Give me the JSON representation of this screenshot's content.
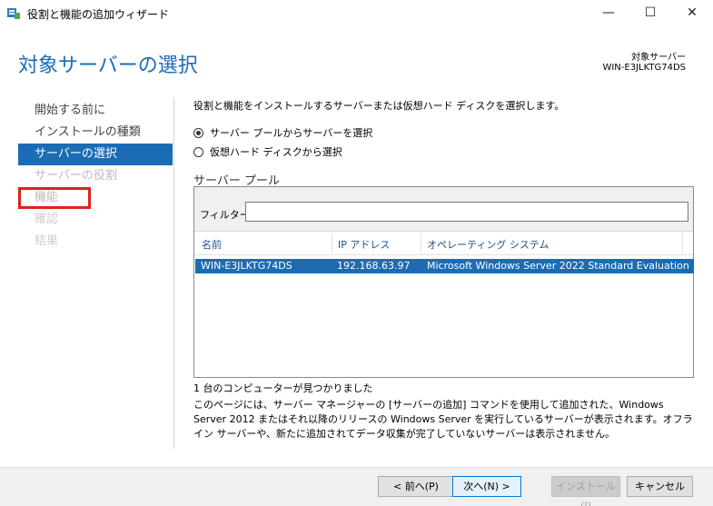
{
  "window": {
    "title": "役割と機能の追加ウィザード",
    "minimize_glyph": "—",
    "maximize_glyph": "☐",
    "close_glyph": "✕"
  },
  "header": {
    "page_title": "対象サーバーの選択",
    "target_label": "対象サーバー",
    "target_name": "WIN-E3JLKTG74DS"
  },
  "nav": {
    "items": [
      {
        "label": "開始する前に"
      },
      {
        "label": "インストールの種類"
      },
      {
        "label": "サーバーの選択"
      },
      {
        "label": "サーバーの役割"
      },
      {
        "label": "機能"
      },
      {
        "label": "確認"
      },
      {
        "label": "結果"
      }
    ]
  },
  "content": {
    "instruction": "役割と機能をインストールするサーバーまたは仮想ハード ディスクを選択します。",
    "radio_pool": "サーバー プールからサーバーを選択",
    "radio_vhd": "仮想ハード ディスクから選択",
    "pool_label": "サーバー プール",
    "filter_label": "フィルター:",
    "filter_value": "",
    "columns": [
      "名前",
      "IP アドレス",
      "オペレーティング システム"
    ],
    "rows": [
      {
        "name": "WIN-E3JLKTG74DS",
        "ip": "192.168.63.97",
        "os": "Microsoft Windows Server 2022 Standard Evaluation"
      }
    ],
    "found_text": "1 台のコンピューターが見つかりました",
    "note": "このページには、サーバー マネージャーの [サーバーの追加] コマンドを使用して追加された、Windows Server 2012 またはそれ以降のリリースの Windows Server を実行しているサーバーが表示されます。オフライン サーバーや、新たに追加されてデータ収集が完了していないサーバーは表示されません。"
  },
  "footer": {
    "prev": "< 前へ(P)",
    "next": "次へ(N) >",
    "install": "インストール(I)",
    "cancel": "キャンセル"
  },
  "colors": {
    "accent": "#1b6cb5",
    "highlight_box": "#e0211b"
  }
}
